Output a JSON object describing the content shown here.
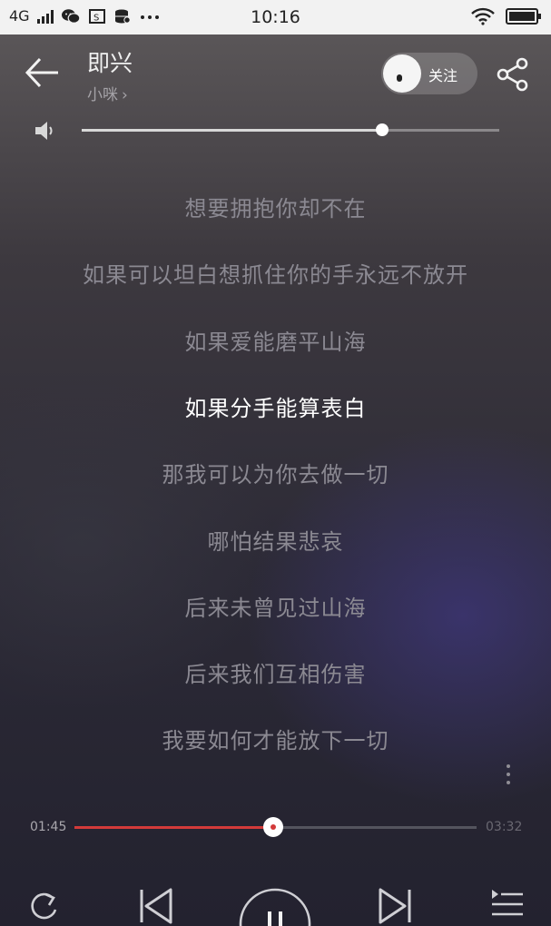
{
  "status_bar": {
    "network": "4G",
    "time": "10:16",
    "app_icons": [
      "wechat-icon",
      "screenshot-icon",
      "storage-icon",
      "more-dots-icon"
    ],
    "wifi": "wifi-icon",
    "battery": "battery-icon"
  },
  "header": {
    "title": "即兴",
    "artist": "小咪",
    "artist_chevron": "›",
    "follow_label": "关注"
  },
  "volume": {
    "level": 0.72
  },
  "lyrics": {
    "current_index": 3,
    "lines": [
      "想要拥抱你却不在",
      "如果可以坦白想抓住你的手永远不放开",
      "如果爱能磨平山海",
      "如果分手能算表白",
      "那我可以为你去做一切",
      "哪怕结果悲哀",
      "后来未曾见过山海",
      "后来我们互相伤害",
      "我要如何才能放下一切"
    ]
  },
  "playback": {
    "current_time": "01:45",
    "total_time": "03:32",
    "progress": 0.495
  },
  "colors": {
    "accent": "#d33a3a",
    "lyric_dim": "#8b8992",
    "lyric_current": "#ffffff"
  }
}
